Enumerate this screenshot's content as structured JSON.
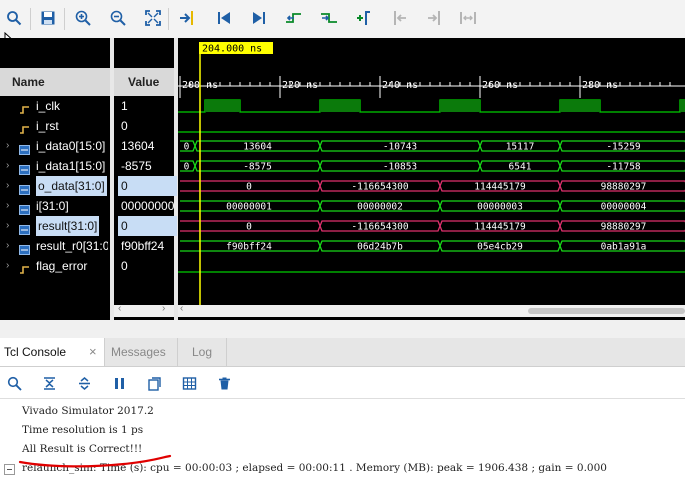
{
  "toolbar": {
    "icons": [
      "search-icon",
      "save-icon",
      "zoom-in-icon",
      "zoom-out-icon",
      "zoom-fit-icon",
      "go-to-cursor-icon",
      "go-to-time-zero-icon",
      "go-to-last-time-icon",
      "previous-transition-icon",
      "next-transition-icon",
      "add-marker-icon",
      "previous-marker-icon",
      "next-marker-icon",
      "swap-cursors-icon"
    ]
  },
  "waveform": {
    "cursor_label": "204.000 ns",
    "headers": {
      "name": "Name",
      "value": "Value"
    },
    "ruler": [
      "200 ns",
      "220 ns",
      "240 ns",
      "260 ns",
      "280 ns"
    ],
    "signals": [
      {
        "name": "i_clk",
        "value": "1",
        "kind": "bit",
        "expandable": false,
        "selected": false
      },
      {
        "name": "i_rst",
        "value": "0",
        "kind": "bit",
        "expandable": false,
        "selected": false
      },
      {
        "name": "i_data0[15:0]",
        "value": "13604",
        "kind": "bus",
        "expandable": true,
        "selected": false,
        "segments": [
          "0",
          "13604",
          "-10743",
          "15117",
          "-15259"
        ]
      },
      {
        "name": "i_data1[15:0]",
        "value": "-8575",
        "kind": "bus",
        "expandable": true,
        "selected": false,
        "segments": [
          "0",
          "-8575",
          "-10853",
          "6541",
          "-11758"
        ]
      },
      {
        "name": "o_data[31:0]",
        "value": "0",
        "kind": "bus",
        "expandable": true,
        "selected": true,
        "segments": [
          "0",
          "-116654300",
          "114445179",
          "98880297"
        ]
      },
      {
        "name": "i[31:0]",
        "value": "00000000",
        "kind": "bus",
        "expandable": true,
        "selected": false,
        "segments": [
          "00000001",
          "00000002",
          "00000003",
          "00000004"
        ]
      },
      {
        "name": "result[31:0]",
        "value": "0",
        "kind": "bus",
        "expandable": true,
        "selected": true,
        "segments": [
          "0",
          "-116654300",
          "114445179",
          "98880297"
        ]
      },
      {
        "name": "result_r0[31:0]",
        "value": "f90bff24",
        "kind": "bus",
        "expandable": true,
        "selected": false,
        "segments": [
          "f90bff24",
          "06d24b7b",
          "05e4cb29",
          "0ab1a91a"
        ]
      },
      {
        "name": "flag_error",
        "value": "0",
        "kind": "bit",
        "expandable": true,
        "selected": false
      }
    ]
  },
  "console": {
    "tabs": [
      {
        "label": "Tcl Console",
        "active": true
      },
      {
        "label": "Messages",
        "active": false
      },
      {
        "label": "Log",
        "active": false
      }
    ],
    "close_glyph": "×",
    "lines": [
      "Vivado Simulator 2017.2",
      "Time resolution is 1 ps",
      "All Result is Correct!!!",
      "relaunch_sim: Time (s): cpu = 00:00:03 ; elapsed = 00:00:11 . Memory (MB): peak = 1906.438 ; gain = 0.000"
    ]
  },
  "colors": {
    "grid_green": "#00cc00",
    "bus_green": "#18d818",
    "selected_bus": "#e0306e",
    "cursor": "#ffff00",
    "annotation_red": "#e00000"
  }
}
